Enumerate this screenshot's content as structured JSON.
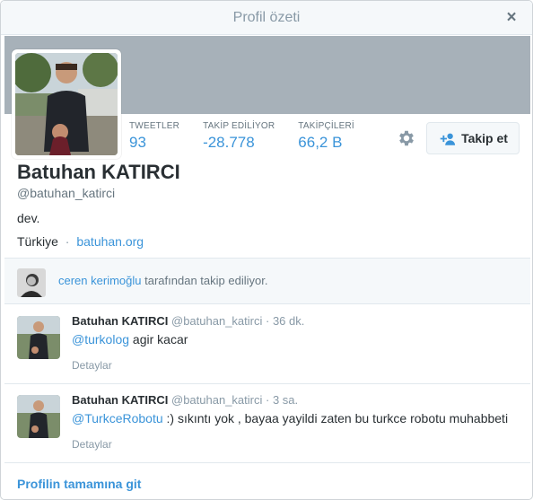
{
  "modal": {
    "title": "Profil özeti",
    "close_symbol": "×"
  },
  "profile": {
    "name": "Batuhan KATIRCI",
    "handle": "@batuhan_katirci",
    "bio": "dev.",
    "location": "Türkiye",
    "separator": "·",
    "url": "batuhan.org",
    "stats": [
      {
        "label": "TWEETLER",
        "value": "93"
      },
      {
        "label": "TAKİP EDİLİYOR",
        "value": "-28.778"
      },
      {
        "label": "TAKİPÇİLERİ",
        "value": "66,2 B"
      }
    ],
    "follow_label": "Takip et"
  },
  "followed_by": {
    "name": "ceren kerimoğlu",
    "suffix": "tarafından takip ediliyor."
  },
  "tweets": [
    {
      "name": "Batuhan KATIRCI",
      "handle": "@batuhan_katirci",
      "time": "· 36 dk.",
      "mention": "@turkolog",
      "text": " agir kacar",
      "details": "Detaylar"
    },
    {
      "name": "Batuhan KATIRCI",
      "handle": "@batuhan_katirci",
      "time": "· 3 sa.",
      "mention": "@TurkceRobotu",
      "text": " :) sıkıntı yok , bayaa yayildi zaten bu turkce robotu muhabbeti",
      "details": "Detaylar"
    }
  ],
  "footer": {
    "link": "Profilin tamamına git"
  },
  "colors": {
    "accent": "#3b94d9",
    "banner": "#a7b1b9",
    "muted": "#8899a6"
  }
}
